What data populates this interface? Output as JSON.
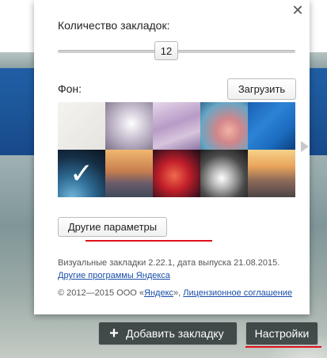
{
  "popup": {
    "bookmarks_count_label": "Количество закладок:",
    "bookmarks_count_value": "12",
    "background_label": "Фон:",
    "upload_button": "Загрузить",
    "other_params_button": "Другие параметры",
    "version_text": "Визуальные закладки 2.22.1, дата выпуска 21.08.2015.",
    "other_programs_link": "Другие программы Яндекса",
    "copyright_prefix": "© 2012—2015 ООО «",
    "yandex_link": "Яндекс",
    "copyright_suffix": "»,",
    "license_link": "Лицензионное соглашение",
    "close_symbol": "✕",
    "selected_background_index": 5
  },
  "footer": {
    "add_bookmark_button": "Добавить закладку",
    "settings_button": "Настройки"
  },
  "colors": {
    "highlight_underline": "#e0101a",
    "link": "#1a4ea8"
  }
}
